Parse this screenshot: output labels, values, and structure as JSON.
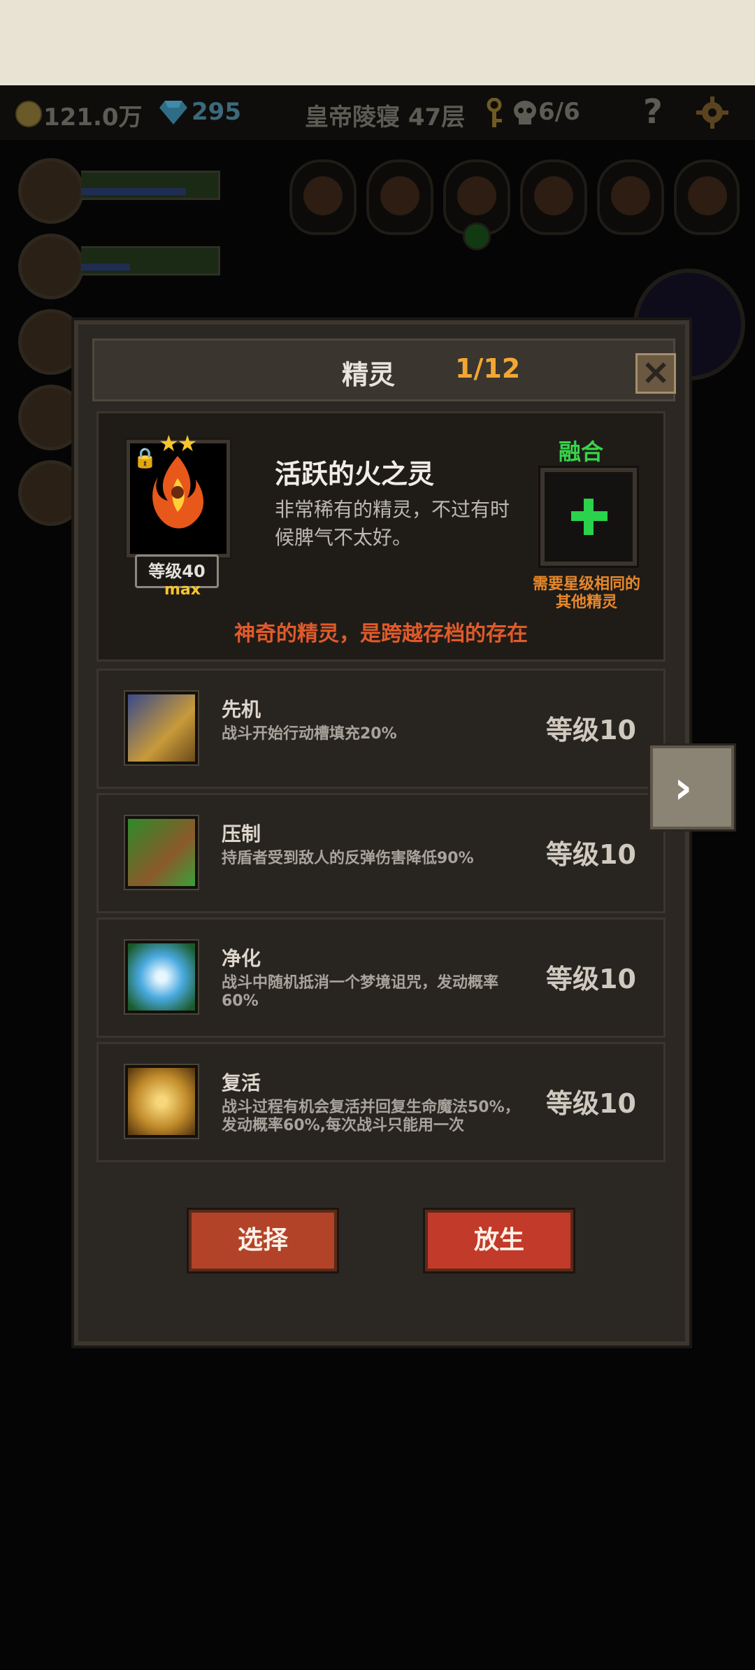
{
  "hud": {
    "gold": "121.0万",
    "gems": "295",
    "location": "皇帝陵寝 47层",
    "keys": "6/6",
    "help": "?"
  },
  "modal": {
    "title": "精灵",
    "counter": "1/12",
    "spirit": {
      "name": "活跃的火之灵",
      "description": "非常稀有的精灵，不过有时候脾气不太好。",
      "stars": "★★",
      "level": "等级40",
      "max_label": "max",
      "tagline": "神奇的精灵，是跨越存档的存在"
    },
    "fuse": {
      "label": "融合",
      "requirement": "需要星级相同的其他精灵"
    },
    "skills": [
      {
        "name": "先机",
        "desc": "战斗开始行动槽填充20%",
        "level": "等级10",
        "icon": "leopard-icon"
      },
      {
        "name": "压制",
        "desc": "持盾者受到敌人的反弹伤害降低90%",
        "level": "等级10",
        "icon": "claw-icon"
      },
      {
        "name": "净化",
        "desc": "战斗中随机抵消一个梦境诅咒，发动概率60%",
        "level": "等级10",
        "icon": "flower-icon"
      },
      {
        "name": "复活",
        "desc": "战斗过程有机会复活并回复生命魔法50%，发动概率60%,每次战斗只能用一次",
        "level": "等级10",
        "icon": "revive-icon"
      }
    ],
    "buttons": {
      "select": "选择",
      "release": "放生"
    }
  },
  "colors": {
    "accent_orange": "#f2a733",
    "fuse_green": "#38d34a",
    "tagline_red": "#e05a2a",
    "button_red": "#b24328"
  }
}
